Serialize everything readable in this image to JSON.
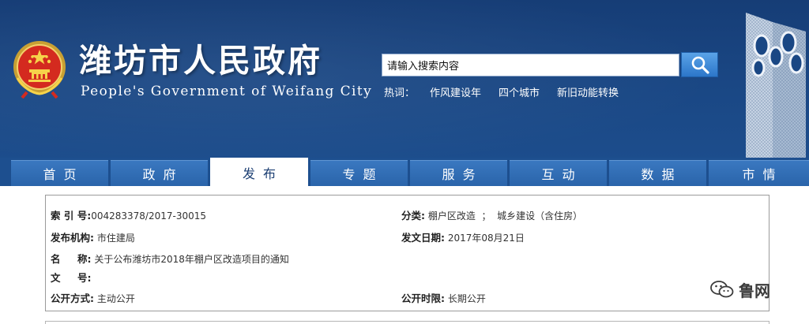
{
  "header": {
    "title": "潍坊市人民政府",
    "subtitle": "People's Government of Weifang City",
    "emblem_icon": "national-emblem-icon",
    "tower_icon": "landmark-tower-icon"
  },
  "search": {
    "value": "请输入搜索内容",
    "button_icon": "search-icon"
  },
  "hotwords": {
    "label": "热词：",
    "items": [
      "作风建设年",
      "四个城市",
      "新旧动能转换"
    ]
  },
  "nav": {
    "tabs": [
      "首页",
      "政府",
      "发布",
      "专题",
      "服务",
      "互动",
      "数据",
      "市情"
    ],
    "active_index": 2
  },
  "info": {
    "index_label": "索 引 号:",
    "index_value": "004283378/2017-30015",
    "category_label": "分类:",
    "category_value": "棚户区改造  ；  城乡建设（含住房）",
    "publisher_label": "发布机构:",
    "publisher_value": "市住建局",
    "date_label": "发文日期:",
    "date_value": "2017年08月21日",
    "name_label_a": "名",
    "name_label_b": "称:",
    "name_value": "关于公布潍坊市2018年棚户区改造项目的通知",
    "docno_label_a": "文",
    "docno_label_b": "号:",
    "docno_value": "",
    "method_label": "公开方式:",
    "method_value": "主动公开",
    "period_label": "公开时限:",
    "period_value": "长期公开"
  },
  "watermark": {
    "text": "鲁网",
    "icon": "wechat-icon"
  },
  "colors": {
    "header_bg": "#1a4784",
    "nav_tab": "#2f6db5",
    "search_button": "#3b88d8"
  }
}
